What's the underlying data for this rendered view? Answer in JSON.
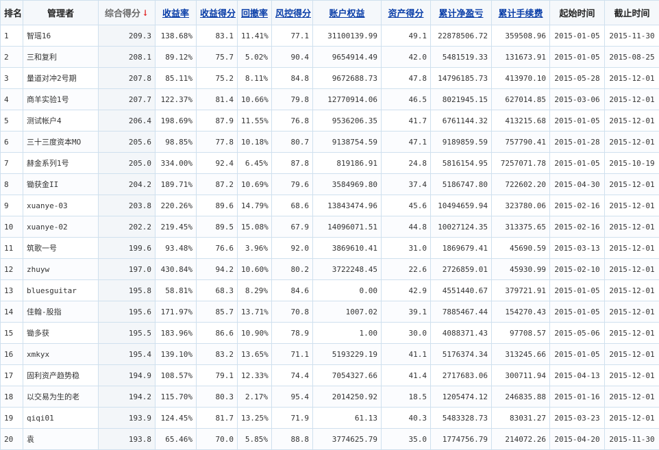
{
  "table": {
    "headers": [
      {
        "key": "rank",
        "label": "排名",
        "sortable": false
      },
      {
        "key": "total_score",
        "label": "综合得分",
        "sortable": true,
        "sorted": true,
        "sort_icon": "arrow-down-icon"
      },
      {
        "key": "return_rate",
        "label": "收益率",
        "sortable": true
      },
      {
        "key": "return_score",
        "label": "收益得分",
        "sortable": true
      },
      {
        "key": "drawdown",
        "label": "回撤率",
        "sortable": true
      },
      {
        "key": "risk_score",
        "label": "风控得分",
        "sortable": true
      },
      {
        "key": "equity",
        "label": "账户权益",
        "sortable": true
      },
      {
        "key": "asset_score",
        "label": "资产得分",
        "sortable": true
      },
      {
        "key": "net_profit",
        "label": "累计净盈亏",
        "sortable": true
      },
      {
        "key": "fees",
        "label": "累计手续费",
        "sortable": true
      },
      {
        "key": "start",
        "label": "起始时间",
        "sortable": false
      },
      {
        "key": "end",
        "label": "截止时间",
        "sortable": false
      }
    ],
    "name_header": "管理者",
    "arrow_glyph": "↓",
    "rows": [
      {
        "rank": "1",
        "name": "智瑶16",
        "total_score": "209.3",
        "return_rate": "138.68%",
        "return_score": "83.1",
        "drawdown": "11.41%",
        "risk_score": "77.1",
        "equity": "31100139.99",
        "asset_score": "49.1",
        "net_profit": "22878506.72",
        "fees": "359508.96",
        "start": "2015-01-05",
        "end": "2015-11-30"
      },
      {
        "rank": "2",
        "name": "三和复利",
        "total_score": "208.1",
        "return_rate": "89.12%",
        "return_score": "75.7",
        "drawdown": "5.02%",
        "risk_score": "90.4",
        "equity": "9654914.49",
        "asset_score": "42.0",
        "net_profit": "5481519.33",
        "fees": "131673.91",
        "start": "2015-01-05",
        "end": "2015-08-25"
      },
      {
        "rank": "3",
        "name": "量道对冲2号期",
        "total_score": "207.8",
        "return_rate": "85.11%",
        "return_score": "75.2",
        "drawdown": "8.11%",
        "risk_score": "84.8",
        "equity": "9672688.73",
        "asset_score": "47.8",
        "net_profit": "14796185.73",
        "fees": "413970.10",
        "start": "2015-05-28",
        "end": "2015-12-01"
      },
      {
        "rank": "4",
        "name": "商羊实验1号",
        "total_score": "207.7",
        "return_rate": "122.37%",
        "return_score": "81.4",
        "drawdown": "10.66%",
        "risk_score": "79.8",
        "equity": "12770914.06",
        "asset_score": "46.5",
        "net_profit": "8021945.15",
        "fees": "627014.85",
        "start": "2015-03-06",
        "end": "2015-12-01"
      },
      {
        "rank": "5",
        "name": "测试帐户4",
        "total_score": "206.4",
        "return_rate": "198.69%",
        "return_score": "87.9",
        "drawdown": "11.55%",
        "risk_score": "76.8",
        "equity": "9536206.35",
        "asset_score": "41.7",
        "net_profit": "6761144.32",
        "fees": "413215.68",
        "start": "2015-01-05",
        "end": "2015-12-01"
      },
      {
        "rank": "6",
        "name": "三十三度资本MO",
        "total_score": "205.6",
        "return_rate": "98.85%",
        "return_score": "77.8",
        "drawdown": "10.18%",
        "risk_score": "80.7",
        "equity": "9138754.59",
        "asset_score": "47.1",
        "net_profit": "9189859.59",
        "fees": "757790.41",
        "start": "2015-01-28",
        "end": "2015-12-01"
      },
      {
        "rank": "7",
        "name": "赫金系列1号",
        "total_score": "205.0",
        "return_rate": "334.00%",
        "return_score": "92.4",
        "drawdown": "6.45%",
        "risk_score": "87.8",
        "equity": "819186.91",
        "asset_score": "24.8",
        "net_profit": "5816154.95",
        "fees": "7257071.78",
        "start": "2015-01-05",
        "end": "2015-10-19"
      },
      {
        "rank": "8",
        "name": "锄获金II",
        "total_score": "204.2",
        "return_rate": "189.71%",
        "return_score": "87.2",
        "drawdown": "10.69%",
        "risk_score": "79.6",
        "equity": "3584969.80",
        "asset_score": "37.4",
        "net_profit": "5186747.80",
        "fees": "722602.20",
        "start": "2015-04-30",
        "end": "2015-12-01"
      },
      {
        "rank": "9",
        "name": "xuanye-03",
        "total_score": "203.8",
        "return_rate": "220.26%",
        "return_score": "89.6",
        "drawdown": "14.79%",
        "risk_score": "68.6",
        "equity": "13843474.96",
        "asset_score": "45.6",
        "net_profit": "10494659.94",
        "fees": "323780.06",
        "start": "2015-02-16",
        "end": "2015-12-01"
      },
      {
        "rank": "10",
        "name": "xuanye-02",
        "total_score": "202.2",
        "return_rate": "219.45%",
        "return_score": "89.5",
        "drawdown": "15.08%",
        "risk_score": "67.9",
        "equity": "14096071.51",
        "asset_score": "44.8",
        "net_profit": "10027124.35",
        "fees": "313375.65",
        "start": "2015-02-16",
        "end": "2015-12-01"
      },
      {
        "rank": "11",
        "name": "筑歌一号",
        "total_score": "199.6",
        "return_rate": "93.48%",
        "return_score": "76.6",
        "drawdown": "3.96%",
        "risk_score": "92.0",
        "equity": "3869610.41",
        "asset_score": "31.0",
        "net_profit": "1869679.41",
        "fees": "45690.59",
        "start": "2015-03-13",
        "end": "2015-12-01"
      },
      {
        "rank": "12",
        "name": "zhuyw",
        "total_score": "197.0",
        "return_rate": "430.84%",
        "return_score": "94.2",
        "drawdown": "10.60%",
        "risk_score": "80.2",
        "equity": "3722248.45",
        "asset_score": "22.6",
        "net_profit": "2726859.01",
        "fees": "45930.99",
        "start": "2015-02-10",
        "end": "2015-12-01"
      },
      {
        "rank": "13",
        "name": "bluesguitar",
        "total_score": "195.8",
        "return_rate": "58.81%",
        "return_score": "68.3",
        "drawdown": "8.29%",
        "risk_score": "84.6",
        "equity": "0.00",
        "asset_score": "42.9",
        "net_profit": "4551440.67",
        "fees": "379721.91",
        "start": "2015-01-05",
        "end": "2015-12-01"
      },
      {
        "rank": "14",
        "name": "佳翰-股指",
        "total_score": "195.6",
        "return_rate": "171.97%",
        "return_score": "85.7",
        "drawdown": "13.71%",
        "risk_score": "70.8",
        "equity": "1007.02",
        "asset_score": "39.1",
        "net_profit": "7885467.44",
        "fees": "154270.43",
        "start": "2015-01-05",
        "end": "2015-12-01"
      },
      {
        "rank": "15",
        "name": "锄多获",
        "total_score": "195.5",
        "return_rate": "183.96%",
        "return_score": "86.6",
        "drawdown": "10.90%",
        "risk_score": "78.9",
        "equity": "1.00",
        "asset_score": "30.0",
        "net_profit": "4088371.43",
        "fees": "97708.57",
        "start": "2015-05-06",
        "end": "2015-12-01"
      },
      {
        "rank": "16",
        "name": "xmkyx",
        "total_score": "195.4",
        "return_rate": "139.10%",
        "return_score": "83.2",
        "drawdown": "13.65%",
        "risk_score": "71.1",
        "equity": "5193229.19",
        "asset_score": "41.1",
        "net_profit": "5176374.34",
        "fees": "313245.66",
        "start": "2015-01-05",
        "end": "2015-12-01"
      },
      {
        "rank": "17",
        "name": "固利资产趋势稳",
        "total_score": "194.9",
        "return_rate": "108.57%",
        "return_score": "79.1",
        "drawdown": "12.33%",
        "risk_score": "74.4",
        "equity": "7054327.66",
        "asset_score": "41.4",
        "net_profit": "2717683.06",
        "fees": "300711.94",
        "start": "2015-04-13",
        "end": "2015-12-01"
      },
      {
        "rank": "18",
        "name": "以交易为生的老",
        "total_score": "194.2",
        "return_rate": "115.70%",
        "return_score": "80.3",
        "drawdown": "2.17%",
        "risk_score": "95.4",
        "equity": "2014250.92",
        "asset_score": "18.5",
        "net_profit": "1205474.12",
        "fees": "246835.88",
        "start": "2015-01-16",
        "end": "2015-12-01"
      },
      {
        "rank": "19",
        "name": "qiqi01",
        "total_score": "193.9",
        "return_rate": "124.45%",
        "return_score": "81.7",
        "drawdown": "13.25%",
        "risk_score": "71.9",
        "equity": "61.13",
        "asset_score": "40.3",
        "net_profit": "5483328.73",
        "fees": "83031.27",
        "start": "2015-03-23",
        "end": "2015-12-01"
      },
      {
        "rank": "20",
        "name": "袁",
        "total_score": "193.8",
        "return_rate": "65.46%",
        "return_score": "70.0",
        "drawdown": "5.85%",
        "risk_score": "88.8",
        "equity": "3774625.79",
        "asset_score": "35.0",
        "net_profit": "1774756.79",
        "fees": "214072.26",
        "start": "2015-04-20",
        "end": "2015-11-30"
      }
    ]
  },
  "colors": {
    "header_link": "#0a3ea8",
    "sort_arrow": "#e01c1c",
    "profit_text": "#d01818",
    "border": "#cfe0ee"
  }
}
